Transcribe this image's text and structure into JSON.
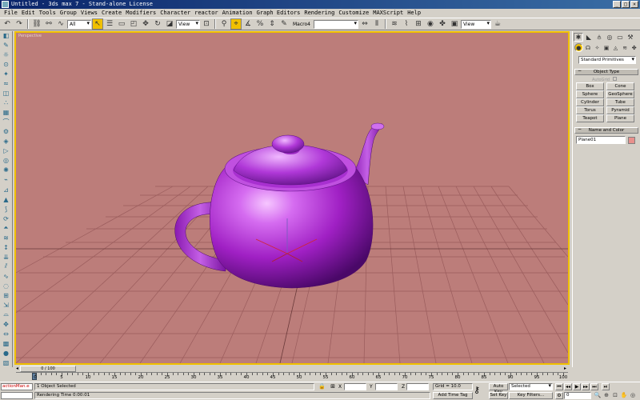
{
  "window": {
    "title": "Untitled - 3ds max 7 - Stand-alone License",
    "controls": [
      "_",
      "□",
      "×"
    ]
  },
  "menu": [
    "File",
    "Edit",
    "Tools",
    "Group",
    "Views",
    "Create",
    "Modifiers",
    "Character",
    "reactor",
    "Animation",
    "Graph Editors",
    "Rendering",
    "Customize",
    "MAXScript",
    "Help"
  ],
  "toolbar": {
    "filter_value": "All",
    "refcoord_value": "View",
    "selection_set_label": "Macro4",
    "named_selection_value": "",
    "render_type_value": "View"
  },
  "viewport": {
    "label": "Perspective",
    "bg_color": "#bc7d7a",
    "teapot_color": "#b040d0",
    "active_border": "#f0c000"
  },
  "command_panel": {
    "category_dropdown": "Standard Primitives",
    "object_type": {
      "header": "Object Type",
      "autogrid": "AutoGrid",
      "buttons": [
        "Box",
        "Cone",
        "Sphere",
        "GeoSphere",
        "Cylinder",
        "Tube",
        "Torus",
        "Pyramid",
        "Teapot",
        "Plane"
      ]
    },
    "name_color": {
      "header": "Name and Color",
      "name_value": "Plane01",
      "swatch_color": "#e8908c"
    }
  },
  "timeline": {
    "frame_display": "0 / 100",
    "ticks": [
      "0",
      "5",
      "10",
      "15",
      "20",
      "25",
      "30",
      "35",
      "40",
      "45",
      "50",
      "55",
      "60",
      "65",
      "70",
      "75",
      "80",
      "85",
      "90",
      "95",
      "100"
    ]
  },
  "status": {
    "maxscript_text": "actionMan.e",
    "selection_text": "1 Object Selected",
    "prompt_text": "Rendering Time  0:00:01",
    "x_label": "X",
    "y_label": "Y",
    "z_label": "Z",
    "grid_text": "Grid = 10.0",
    "add_time_tag": "Add Time Tag",
    "auto_key": "Auto Key",
    "set_key": "Set Key",
    "selected_dropdown": "Selected",
    "key_filters": "Key Filters...",
    "current_frame": "0"
  }
}
